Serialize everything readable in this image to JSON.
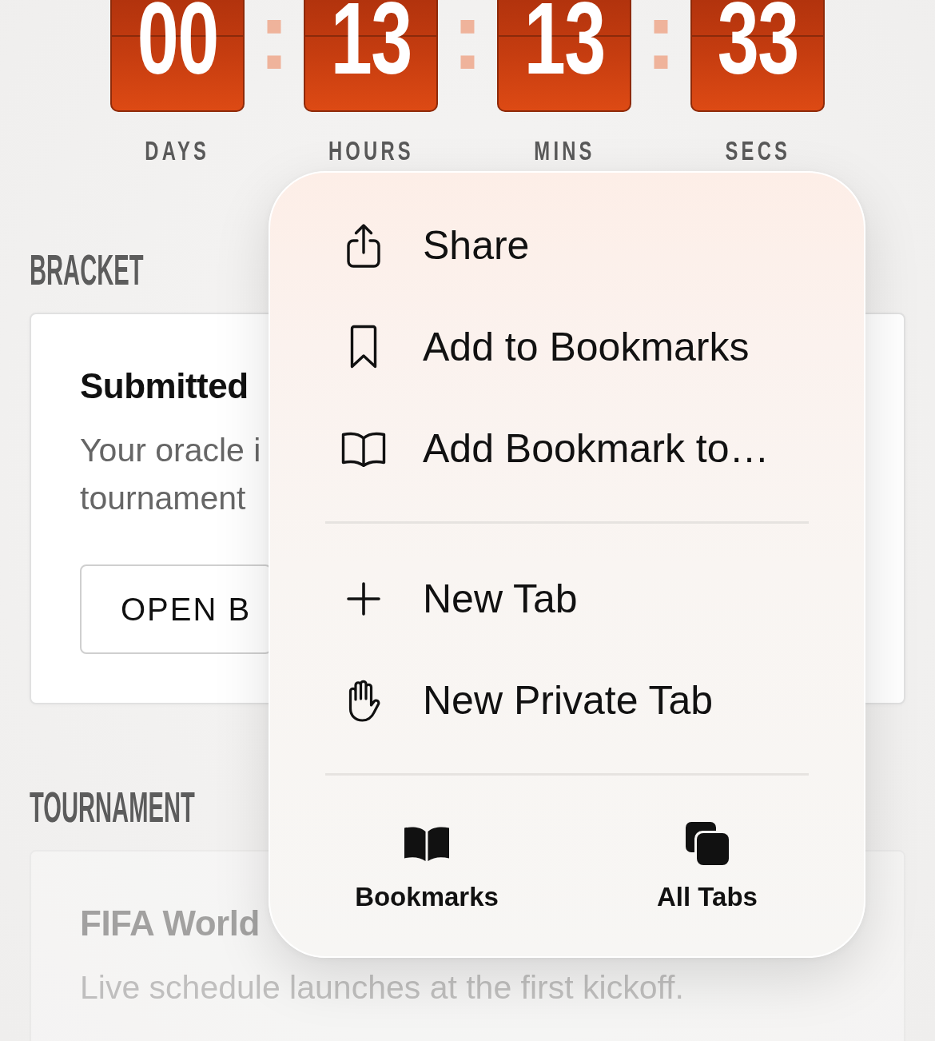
{
  "countdown": {
    "units": [
      {
        "value": "00",
        "label": "DAYS"
      },
      {
        "value": "13",
        "label": "HOURS"
      },
      {
        "value": "13",
        "label": "MINS"
      },
      {
        "value": "33",
        "label": "SECS"
      }
    ],
    "separators": [
      ":",
      ":",
      ":"
    ]
  },
  "sections": [
    {
      "heading": "BRACKET",
      "card": {
        "title": "Submitted",
        "body_lines": [
          "Your oracle i",
          "tournament"
        ],
        "button": "OPEN B",
        "disabled": false
      }
    },
    {
      "heading": "TOURNAMENT",
      "card": {
        "title": "FIFA World",
        "body_lines": [
          "Live schedule launches at the first kickoff."
        ],
        "disabled": true
      }
    }
  ],
  "menu": {
    "groups": [
      {
        "items": [
          {
            "label": "Share"
          },
          {
            "label": "Add to Bookmarks"
          },
          {
            "label": "Add Bookmark to…"
          }
        ]
      },
      {
        "items": [
          {
            "label": "New Tab"
          },
          {
            "label": "New Private Tab"
          }
        ]
      }
    ],
    "bottom_buttons": [
      {
        "label": "Bookmarks"
      },
      {
        "label": "All Tabs"
      }
    ]
  }
}
